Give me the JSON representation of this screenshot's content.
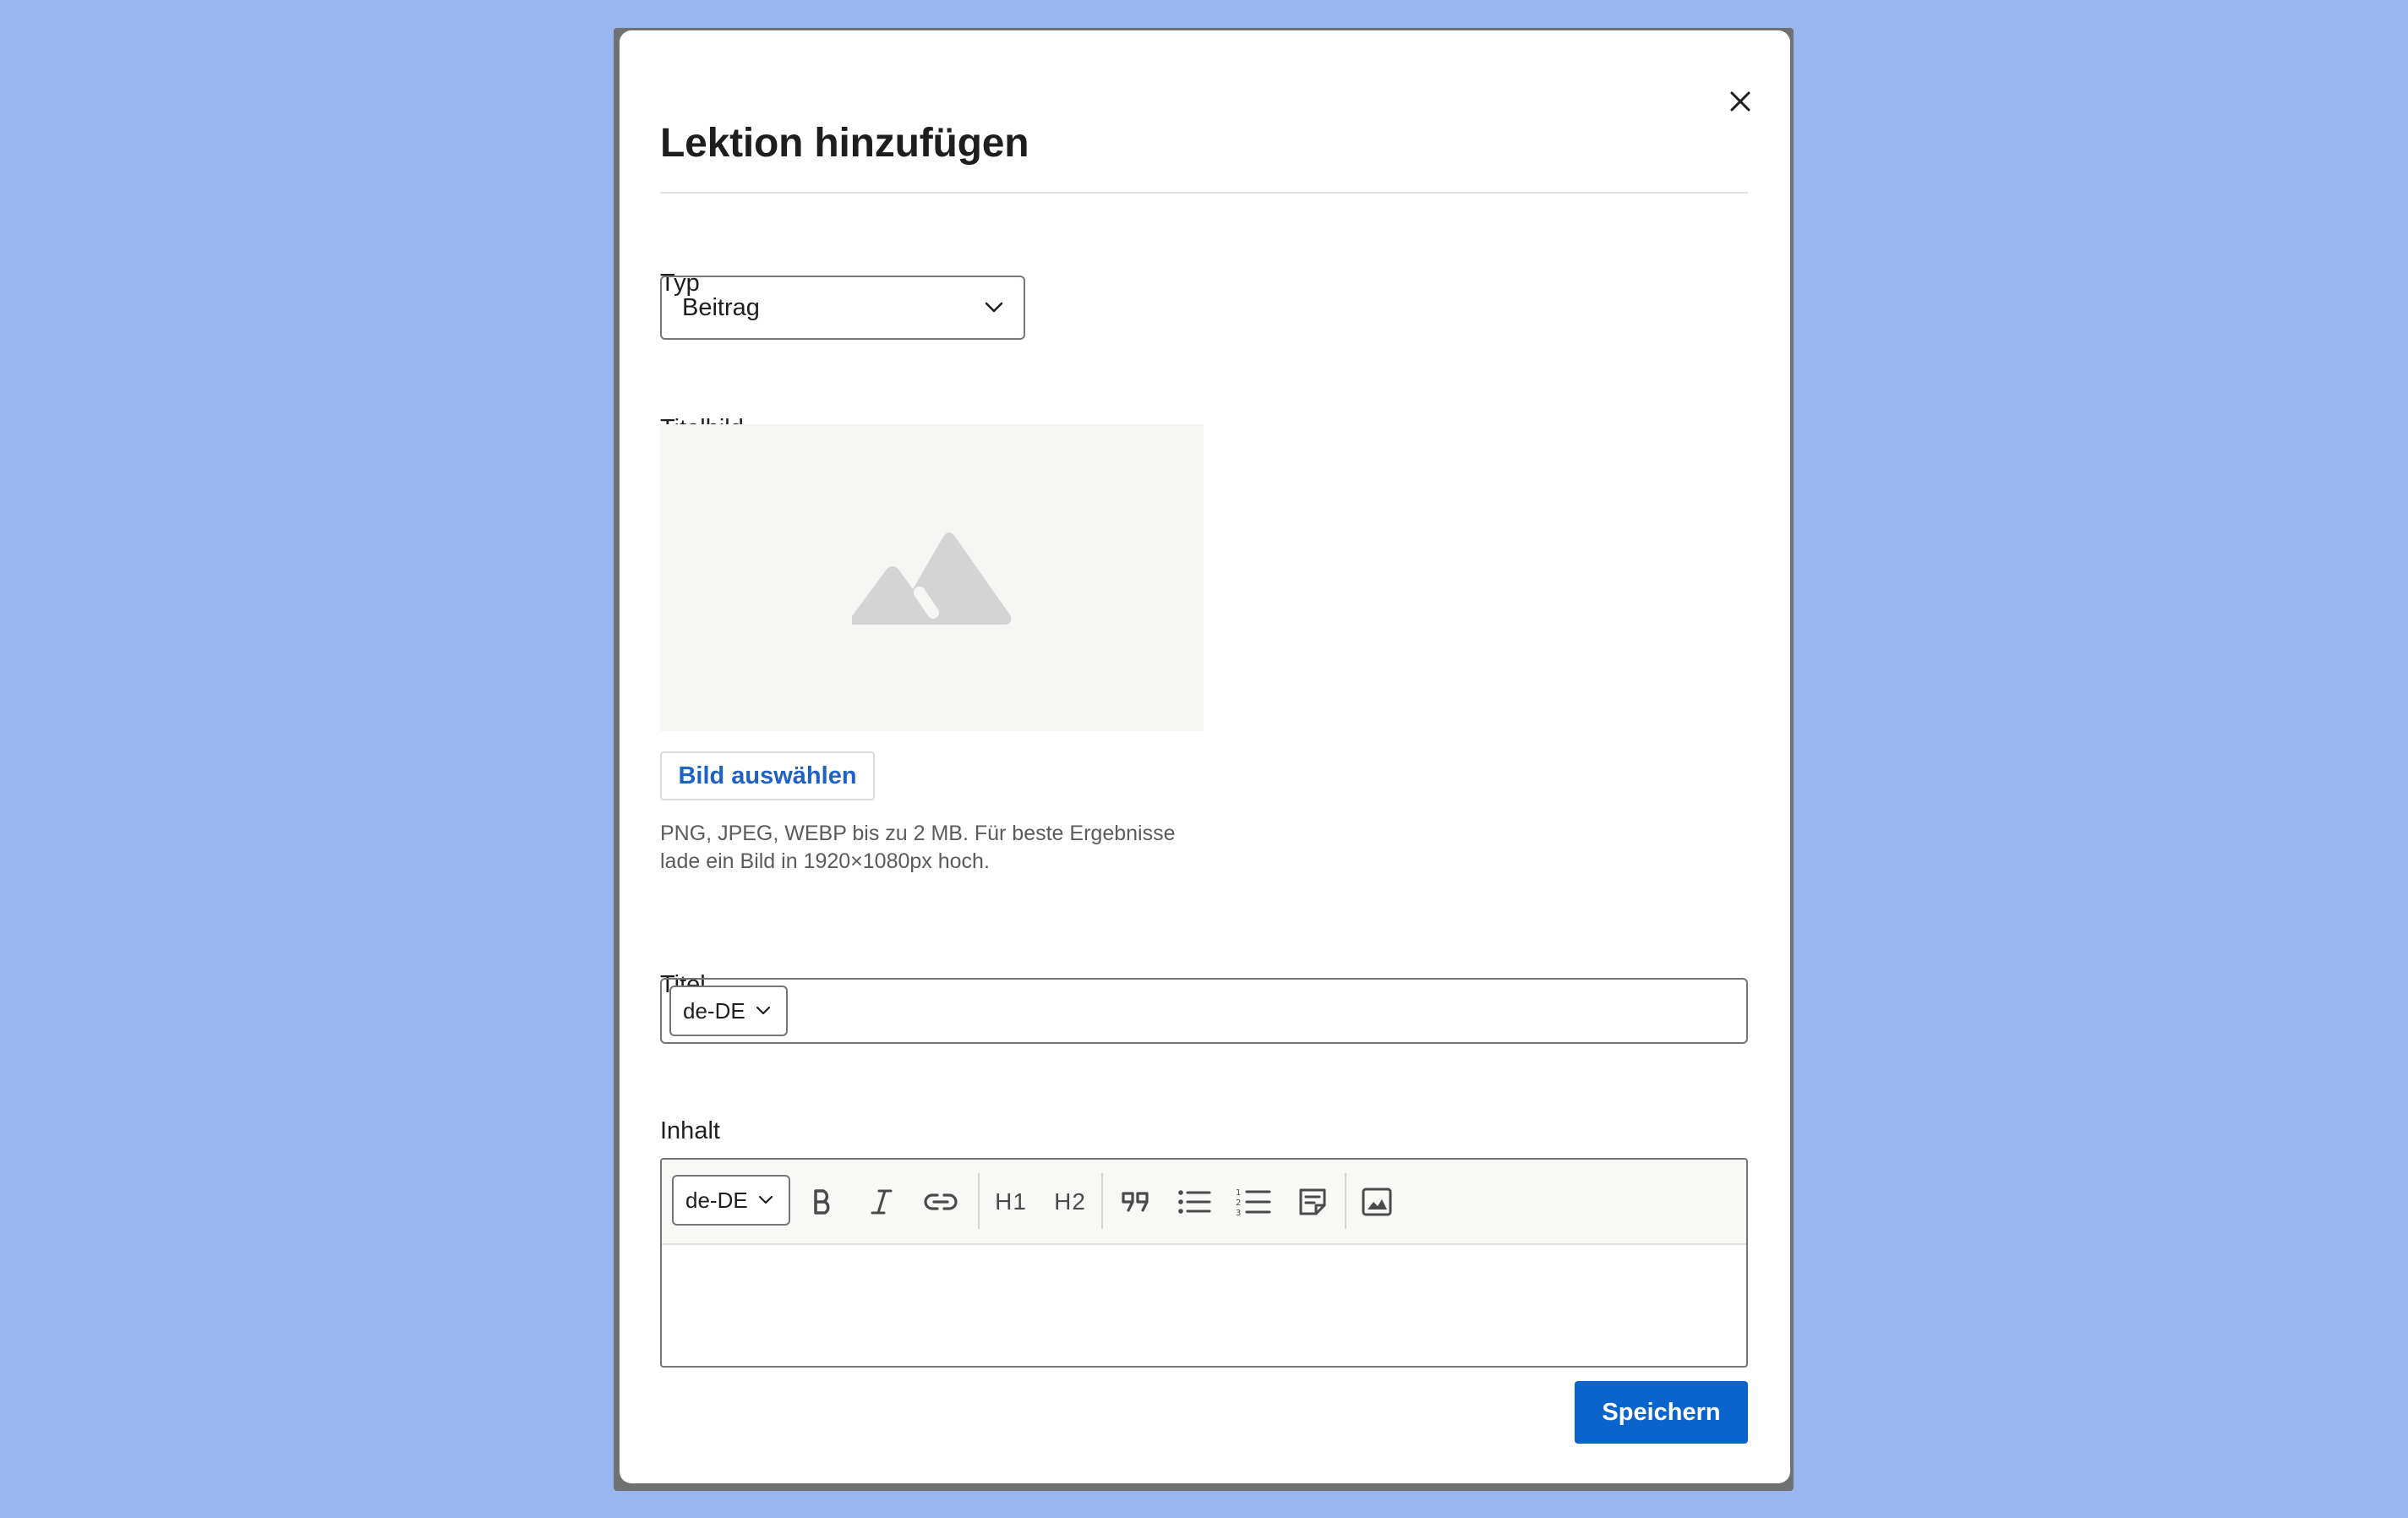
{
  "modal": {
    "title": "Lektion hinzufügen",
    "close_icon": "close-icon"
  },
  "type_field": {
    "label": "Typ",
    "selected": "Beitrag"
  },
  "cover_image": {
    "label": "Titelbild",
    "placeholder_icon": "mountain-image-icon",
    "select_button": "Bild auswählen",
    "hint_line1": "PNG, JPEG, WEBP bis zu 2 MB. Für beste Ergebnisse",
    "hint_line2": "lade ein Bild in 1920×1080px hoch."
  },
  "title_field": {
    "label": "Titel",
    "locale": "de-DE",
    "value": ""
  },
  "content_field": {
    "label": "Inhalt",
    "locale": "de-DE",
    "toolbar": {
      "h1": "H1",
      "h2": "H2"
    }
  },
  "actions": {
    "save": "Speichern"
  },
  "colors": {
    "page_background": "#9ab6ee",
    "primary": "#0b63cc",
    "link": "#1f62c6"
  }
}
